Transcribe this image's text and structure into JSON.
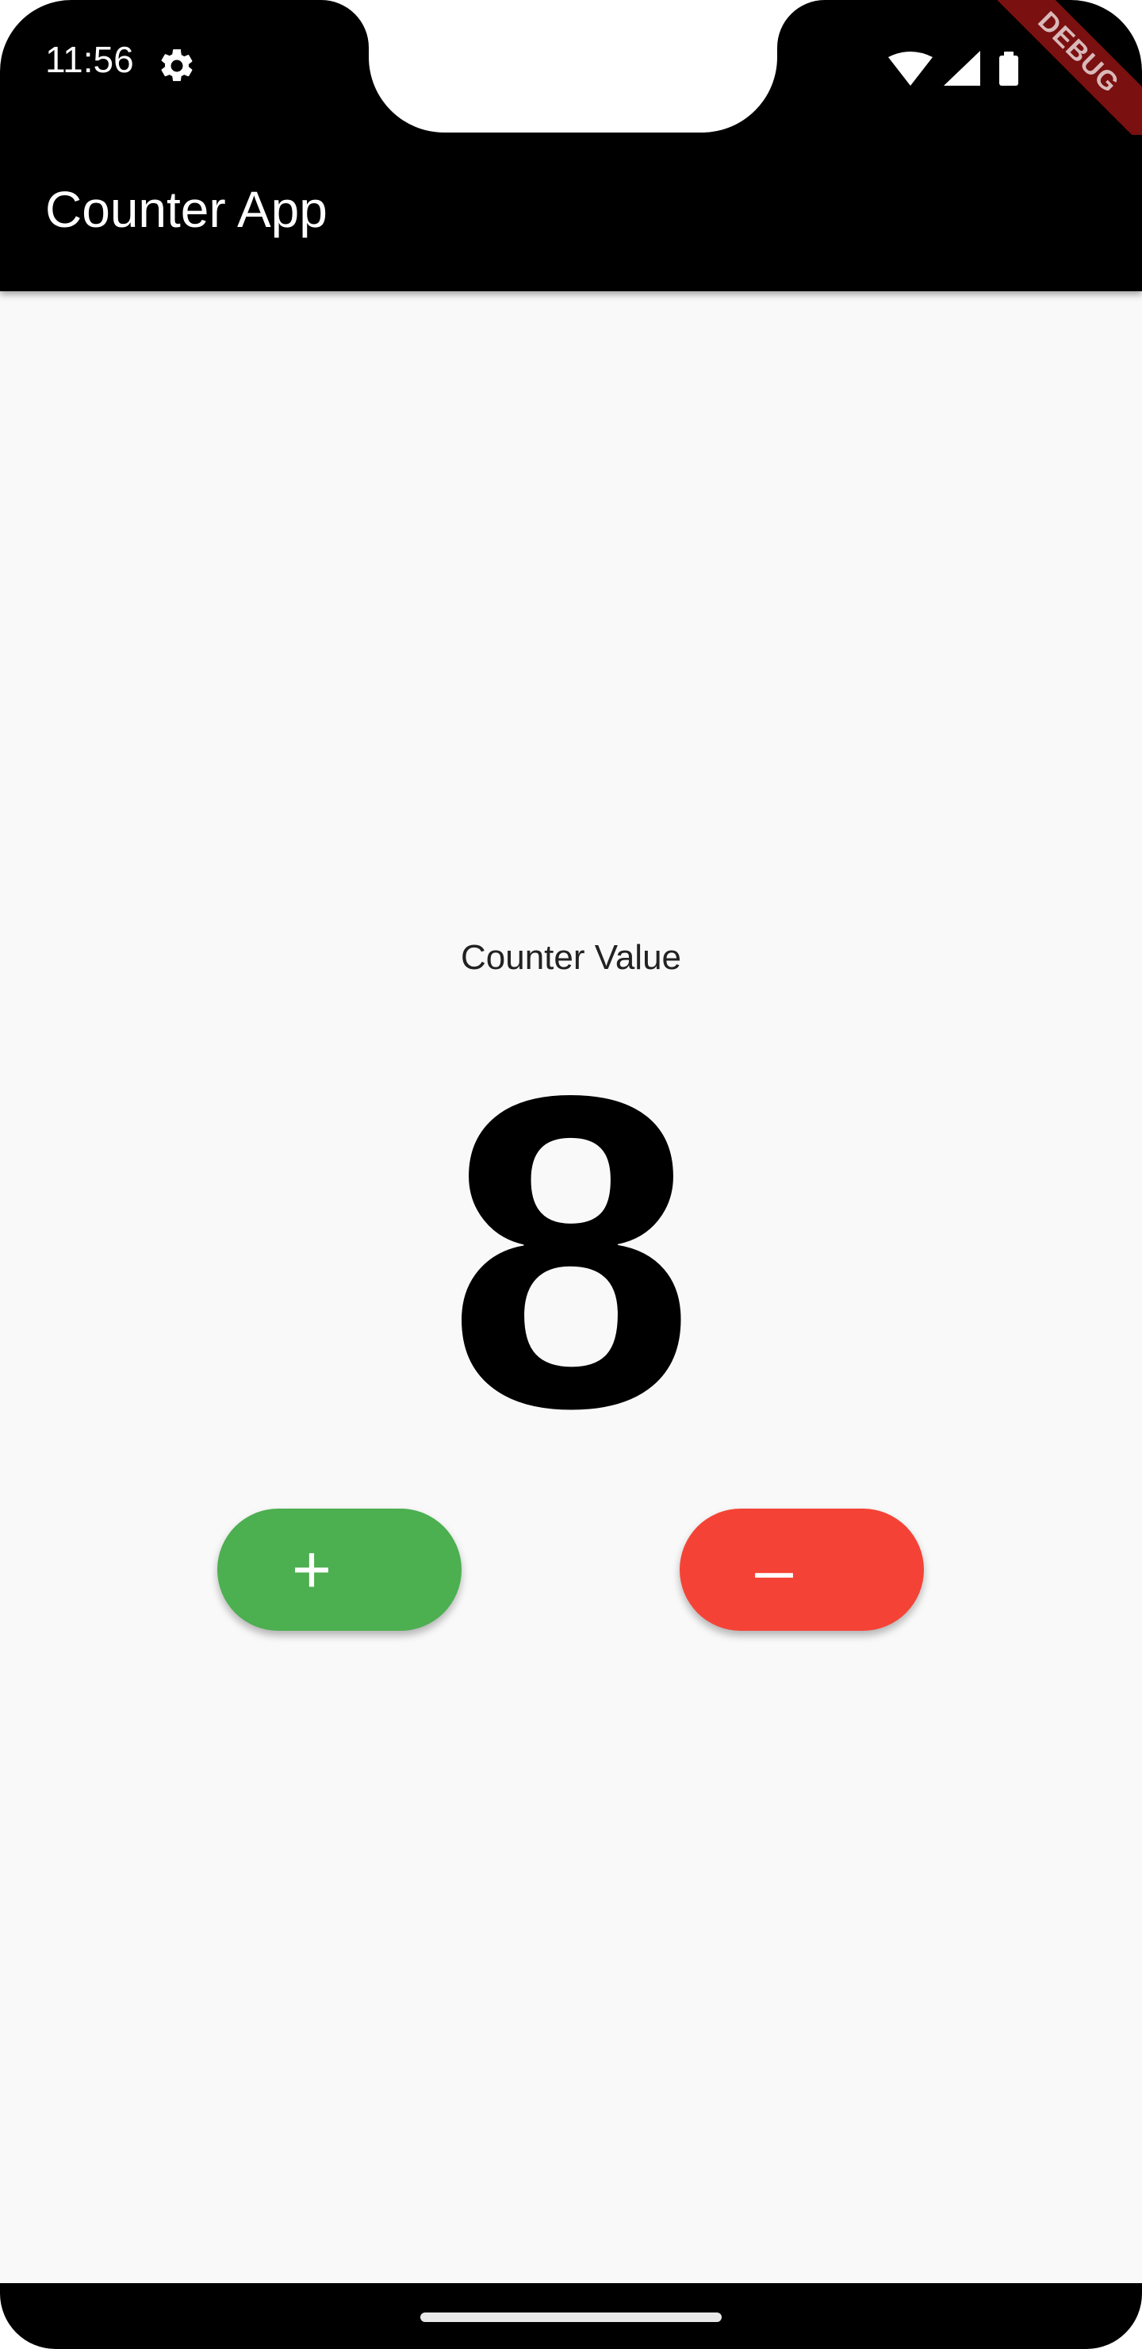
{
  "status_bar": {
    "time": "11:56",
    "settings_icon": "gear-icon",
    "wifi_icon": "wifi-icon",
    "signal_icon": "signal-icon",
    "battery_icon": "battery-icon",
    "debug_label": "DEBUG"
  },
  "app_bar": {
    "title": "Counter App",
    "background_color": "#000000"
  },
  "main": {
    "label": "Counter Value",
    "value": "8",
    "increment_label": "+",
    "decrement_label": "–",
    "increment_color": "#4caf50",
    "decrement_color": "#f44336"
  },
  "nav_bar": {
    "handle_icon": "gesture-handle"
  }
}
